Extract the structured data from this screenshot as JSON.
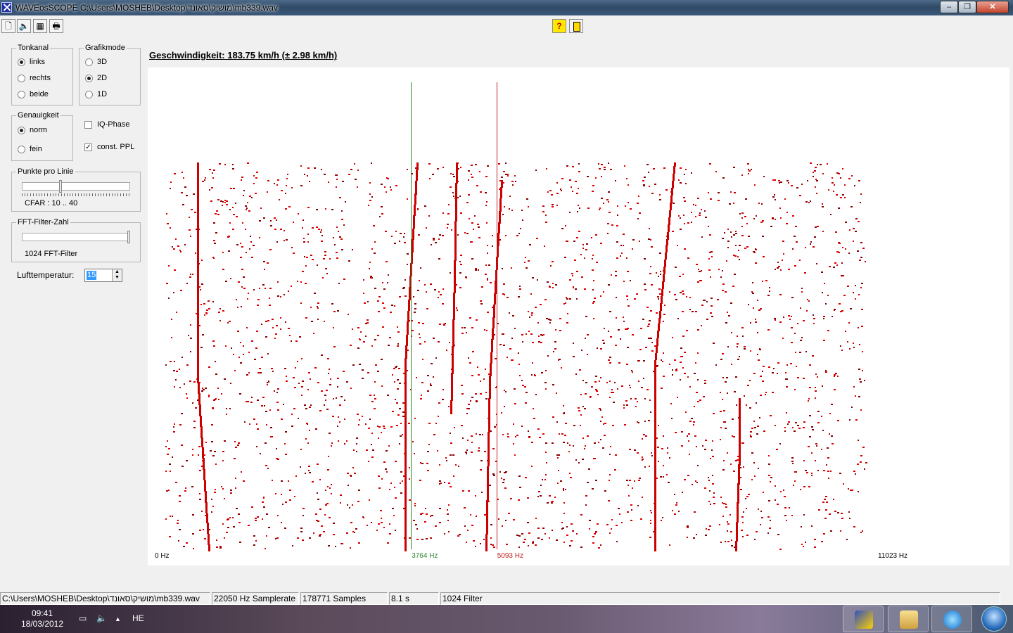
{
  "window": {
    "title": "WAVEosSCOPE  C:\\Users\\MOSHEB\\Desktop\\מושיק\\סאונד\\mb339.wav",
    "minimize": "–",
    "maximize": "❐",
    "close": "✕"
  },
  "toolbar": {
    "new_icon": "🗋",
    "sound_icon": "🔈",
    "chart_icon": "▦",
    "print_icon": "🖶",
    "help_label": "?"
  },
  "tonkanal": {
    "legend": "Tonkanal",
    "options": [
      "links",
      "rechts",
      "beide"
    ],
    "selected": "links"
  },
  "grafikmode": {
    "legend": "Grafikmode",
    "options": [
      "3D",
      "2D",
      "1D"
    ],
    "selected": "2D"
  },
  "genauigkeit": {
    "legend": "Genauigkeit",
    "options": [
      "norm",
      "fein"
    ],
    "selected": "norm"
  },
  "checks": {
    "iq_phase": "IQ-Phase",
    "iq_phase_checked": false,
    "const_ppl": "const. PPL",
    "const_ppl_checked": true
  },
  "punkte": {
    "legend": "Punkte pro Linie",
    "value_text": "CFAR : 10 .. 40",
    "level_fraction": 0.35
  },
  "fft": {
    "legend": "FFT-Filter-Zahl",
    "value_text": "1024 FFT-Filter",
    "level_fraction": 1.0
  },
  "temperature": {
    "label": "Lufttemperatur:",
    "value": "15",
    "up": "▲",
    "down": "▼"
  },
  "speed_text": "Geschwindigkeit: 183.75 km/h (± 2.98 km/h)",
  "spectrum": {
    "x_min_label": "0 Hz",
    "x_max_label": "11023 Hz",
    "x_max": 11023,
    "cursor1_label": "3764 Hz",
    "cursor1_hz": 3764,
    "cursor2_label": "5093 Hz",
    "cursor2_hz": 5093,
    "cursor1_color": "#2e8b2e",
    "cursor2_color": "#c02020",
    "dot_color": "#cc0000"
  },
  "status": {
    "path": "C:\\Users\\MOSHEB\\Desktop\\מושיק\\סאונד\\mb339.wav",
    "samplerate": "22050 Hz Samplerate",
    "samples": "178771 Samples",
    "duration": "8.1 s",
    "filter": "1024 Filter"
  },
  "taskbar": {
    "time": "09:41",
    "date": "18/03/2012",
    "lang": "HE",
    "tray_up": "▲"
  }
}
